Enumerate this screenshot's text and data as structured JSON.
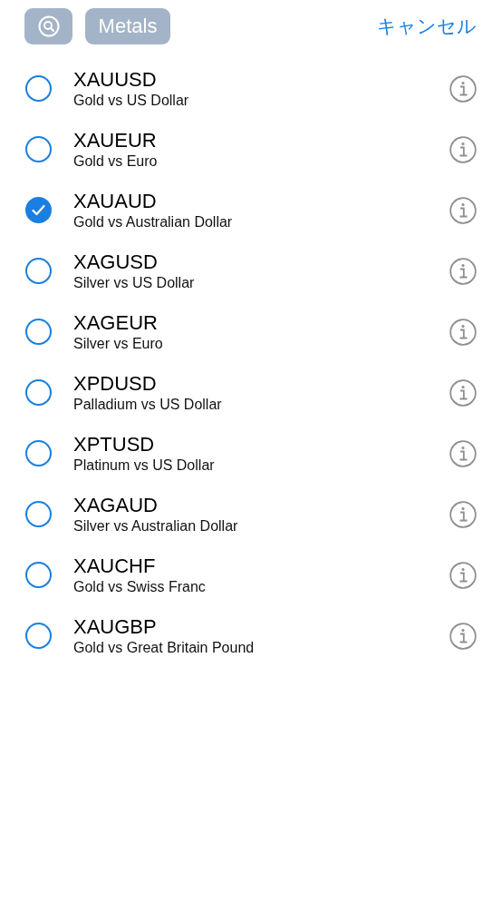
{
  "toolbar": {
    "filter": "Metals",
    "cancel": "キャンセル"
  },
  "symbols": [
    {
      "symbol": "XAUUSD",
      "description": "Gold vs US Dollar",
      "selected": false
    },
    {
      "symbol": "XAUEUR",
      "description": "Gold vs Euro",
      "selected": false
    },
    {
      "symbol": "XAUAUD",
      "description": "Gold vs Australian Dollar",
      "selected": true
    },
    {
      "symbol": "XAGUSD",
      "description": "Silver vs US Dollar",
      "selected": false
    },
    {
      "symbol": "XAGEUR",
      "description": "Silver vs Euro",
      "selected": false
    },
    {
      "symbol": "XPDUSD",
      "description": "Palladium vs US Dollar",
      "selected": false
    },
    {
      "symbol": "XPTUSD",
      "description": "Platinum vs US Dollar",
      "selected": false
    },
    {
      "symbol": "XAGAUD",
      "description": "Silver vs Australian Dollar",
      "selected": false
    },
    {
      "symbol": "XAUCHF",
      "description": "Gold vs Swiss Franc",
      "selected": false
    },
    {
      "symbol": "XAUGBP",
      "description": "Gold vs Great Britain Pound",
      "selected": false
    }
  ]
}
